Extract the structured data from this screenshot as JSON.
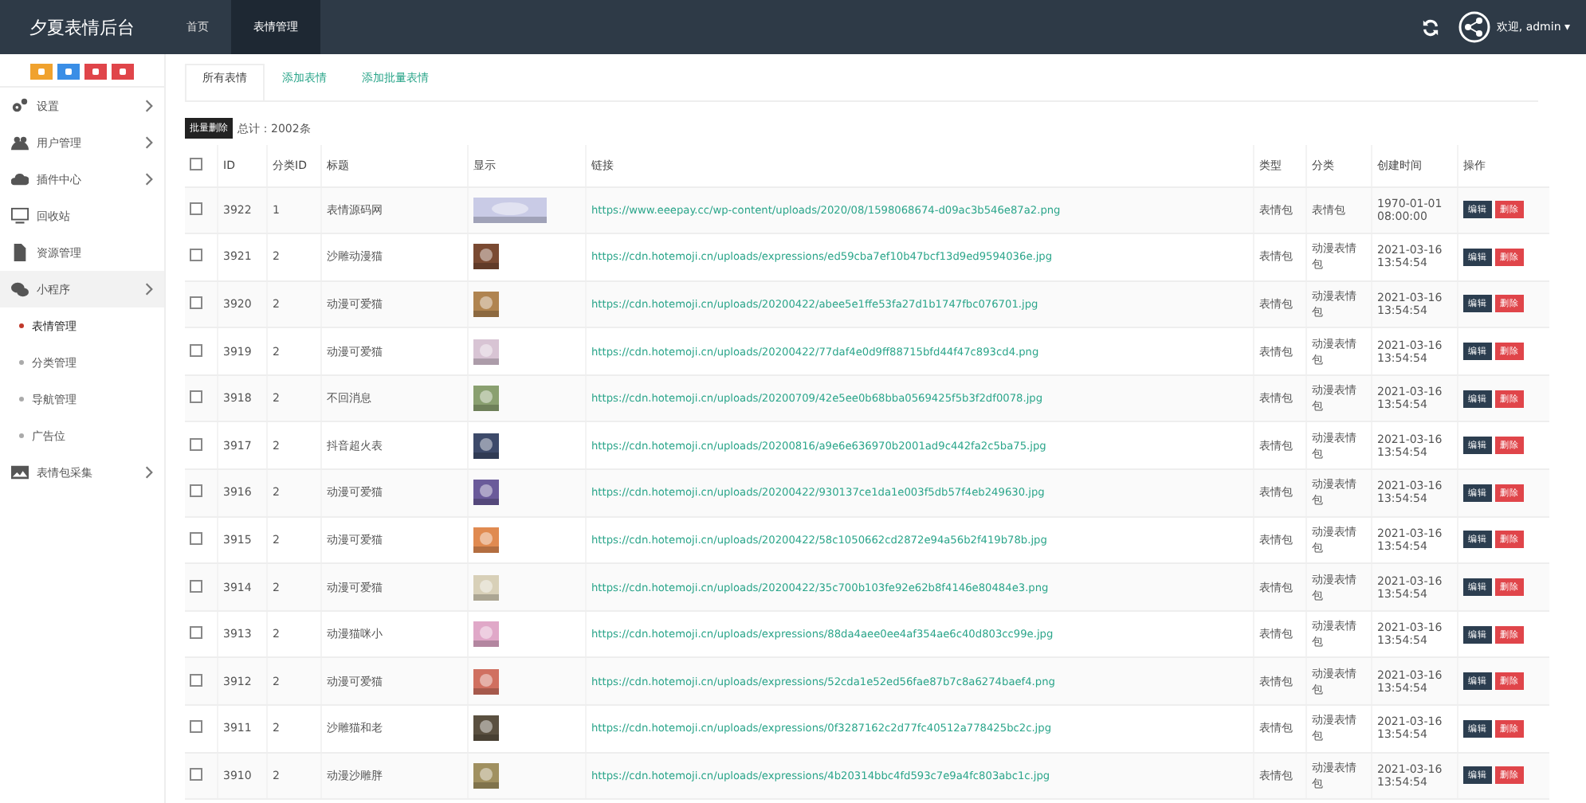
{
  "brand": "夕夏表情后台",
  "nav": [
    {
      "label": "首页",
      "selected": false
    },
    {
      "label": "表情管理",
      "selected": true
    }
  ],
  "user": {
    "greeting": "欢迎, admin",
    "caret": "▾"
  },
  "quick_buttons": [
    {
      "color": "#f0a22e"
    },
    {
      "color": "#3a8ee6"
    },
    {
      "color": "#e0454a"
    },
    {
      "color": "#e0454a"
    }
  ],
  "sidebar": [
    {
      "label": "设置",
      "expanded": false,
      "has_arrow": true
    },
    {
      "label": "用户管理",
      "expanded": false,
      "has_arrow": true
    },
    {
      "label": "插件中心",
      "expanded": false,
      "has_arrow": true
    },
    {
      "label": "回收站",
      "expanded": false,
      "has_arrow": false
    },
    {
      "label": "资源管理",
      "expanded": false,
      "has_arrow": false
    },
    {
      "label": "小程序",
      "expanded": true,
      "has_arrow": true,
      "children": [
        {
          "label": "表情管理",
          "selected": true
        },
        {
          "label": "分类管理",
          "selected": false
        },
        {
          "label": "导航管理",
          "selected": false
        },
        {
          "label": "广告位",
          "selected": false
        }
      ]
    },
    {
      "label": "表情包采集",
      "expanded": false,
      "has_arrow": true
    }
  ],
  "tabs": [
    {
      "label": "所有表情",
      "selected": true
    },
    {
      "label": "添加表情",
      "selected": false
    },
    {
      "label": "添加批量表情",
      "selected": false
    }
  ],
  "batch_delete": "批量删除",
  "total": "总计：2002条",
  "table": {
    "select_all": {
      "checked": false
    },
    "columns": [
      "ID",
      "分类ID",
      "标题",
      "显示",
      "链接",
      "类型",
      "分类",
      "创建时间",
      "操作"
    ],
    "rows": [
      {
        "checked": false,
        "id": "3922",
        "cat_id": "1",
        "title": "表情源码网",
        "link": "https://www.eeepay.cc/wp-content/uploads/2020/08/1598068674-d09ac3b546e87a2.png",
        "type": "表情包",
        "category": "表情包",
        "time": "1970-01-01 08:00:00",
        "actions": [
          "编辑",
          "删除"
        ]
      },
      {
        "checked": false,
        "id": "3921",
        "cat_id": "2",
        "title": "沙雕动漫猫",
        "link": "https://cdn.hotemoji.cn/uploads/expressions/ed59cba7ef10b47bcf13d9ed9594036e.jpg",
        "type": "表情包",
        "category": "动漫表情包",
        "time": "2021-03-16 13:54:54",
        "actions": [
          "编辑",
          "删除"
        ]
      },
      {
        "checked": false,
        "id": "3920",
        "cat_id": "2",
        "title": "动漫可爱猫",
        "link": "https://cdn.hotemoji.cn/uploads/20200422/abee5e1ffe53fa27d1b1747fbc076701.jpg",
        "type": "表情包",
        "category": "动漫表情包",
        "time": "2021-03-16 13:54:54",
        "actions": [
          "编辑",
          "删除"
        ]
      },
      {
        "checked": false,
        "id": "3919",
        "cat_id": "2",
        "title": "动漫可爱猫",
        "link": "https://cdn.hotemoji.cn/uploads/20200422/77daf4e0d9ff88715bfd44f47c893cd4.png",
        "type": "表情包",
        "category": "动漫表情包",
        "time": "2021-03-16 13:54:54",
        "actions": [
          "编辑",
          "删除"
        ]
      },
      {
        "checked": false,
        "id": "3918",
        "cat_id": "2",
        "title": "不回消息",
        "link": "https://cdn.hotemoji.cn/uploads/20200709/42e5ee0b68bba0569425f5b3f2df0078.jpg",
        "type": "表情包",
        "category": "动漫表情包",
        "time": "2021-03-16 13:54:54",
        "actions": [
          "编辑",
          "删除"
        ]
      },
      {
        "checked": false,
        "id": "3917",
        "cat_id": "2",
        "title": "抖音超火表",
        "link": "https://cdn.hotemoji.cn/uploads/20200816/a9e6e636970b2001ad9c442fa2c5ba75.jpg",
        "type": "表情包",
        "category": "动漫表情包",
        "time": "2021-03-16 13:54:54",
        "actions": [
          "编辑",
          "删除"
        ]
      },
      {
        "checked": false,
        "id": "3916",
        "cat_id": "2",
        "title": "动漫可爱猫",
        "link": "https://cdn.hotemoji.cn/uploads/20200422/930137ce1da1e003f5db57f4eb249630.jpg",
        "type": "表情包",
        "category": "动漫表情包",
        "time": "2021-03-16 13:54:54",
        "actions": [
          "编辑",
          "删除"
        ]
      },
      {
        "checked": false,
        "id": "3915",
        "cat_id": "2",
        "title": "动漫可爱猫",
        "link": "https://cdn.hotemoji.cn/uploads/20200422/58c1050662cd2872e94a56b2f419b78b.jpg",
        "type": "表情包",
        "category": "动漫表情包",
        "time": "2021-03-16 13:54:54",
        "actions": [
          "编辑",
          "删除"
        ]
      },
      {
        "checked": false,
        "id": "3914",
        "cat_id": "2",
        "title": "动漫可爱猫",
        "link": "https://cdn.hotemoji.cn/uploads/20200422/35c700b103fe92e62b8f4146e80484e3.png",
        "type": "表情包",
        "category": "动漫表情包",
        "time": "2021-03-16 13:54:54",
        "actions": [
          "编辑",
          "删除"
        ]
      },
      {
        "checked": false,
        "id": "3913",
        "cat_id": "2",
        "title": "动漫猫咪小",
        "link": "https://cdn.hotemoji.cn/uploads/expressions/88da4aee0ee4af354ae6c40d803cc99e.jpg",
        "type": "表情包",
        "category": "动漫表情包",
        "time": "2021-03-16 13:54:54",
        "actions": [
          "编辑",
          "删除"
        ]
      },
      {
        "checked": false,
        "id": "3912",
        "cat_id": "2",
        "title": "动漫可爱猫",
        "link": "https://cdn.hotemoji.cn/uploads/expressions/52cda1e52ed56fae87b7c8a6274baef4.png",
        "type": "表情包",
        "category": "动漫表情包",
        "time": "2021-03-16 13:54:54",
        "actions": [
          "编辑",
          "删除"
        ]
      },
      {
        "checked": false,
        "id": "3911",
        "cat_id": "2",
        "title": "沙雕猫和老",
        "link": "https://cdn.hotemoji.cn/uploads/expressions/0f3287162c2d77fc40512a778425bc2c.jpg",
        "type": "表情包",
        "category": "动漫表情包",
        "time": "2021-03-16 13:54:54",
        "actions": [
          "编辑",
          "删除"
        ]
      },
      {
        "checked": false,
        "id": "3910",
        "cat_id": "2",
        "title": "动漫沙雕胖",
        "link": "https://cdn.hotemoji.cn/uploads/expressions/4b20314bbc4fd593c7e9a4fc803abc1c.jpg",
        "type": "表情包",
        "category": "动漫表情包",
        "time": "2021-03-16 13:54:54",
        "actions": [
          "编辑",
          "删除"
        ]
      }
    ]
  }
}
